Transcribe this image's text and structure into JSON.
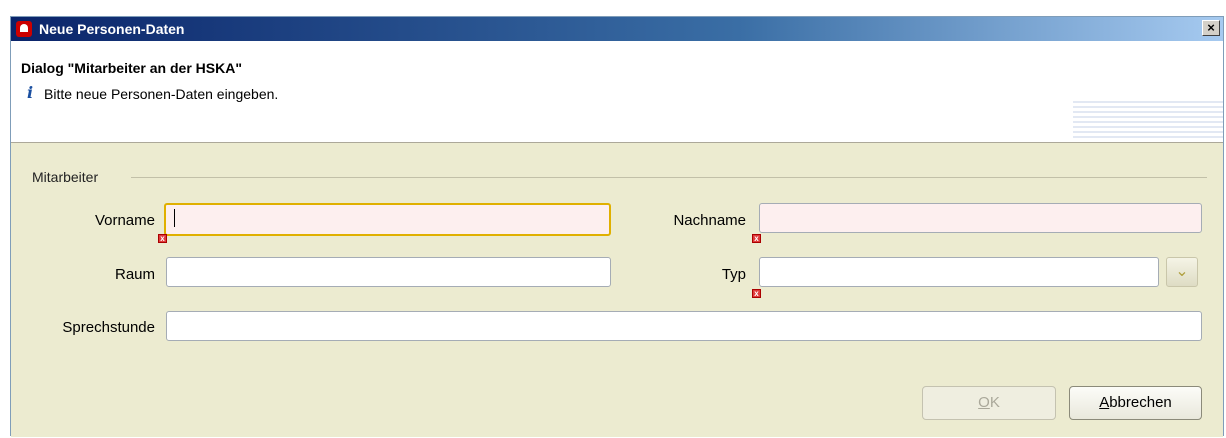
{
  "window": {
    "title": "Neue Personen-Daten",
    "close_glyph": "×"
  },
  "header": {
    "dialog_title": "Dialog \"Mitarbeiter an der HSKA\"",
    "info_glyph": "i",
    "info_text": "Bitte neue Personen-Daten eingeben."
  },
  "form": {
    "group_label": "Mitarbeiter",
    "vorname_label": "Vorname",
    "vorname_value": "",
    "nachname_label": "Nachname",
    "nachname_value": "",
    "raum_label": "Raum",
    "raum_value": "",
    "typ_label": "Typ",
    "typ_value": "",
    "sprechstunde_label": "Sprechstunde",
    "sprechstunde_value": "",
    "error_glyph": "x",
    "dropdown_glyph": "⌄"
  },
  "buttons": {
    "ok_mnemonic": "O",
    "ok_rest": "K",
    "cancel_mnemonic": "A",
    "cancel_rest": "bbrechen"
  }
}
